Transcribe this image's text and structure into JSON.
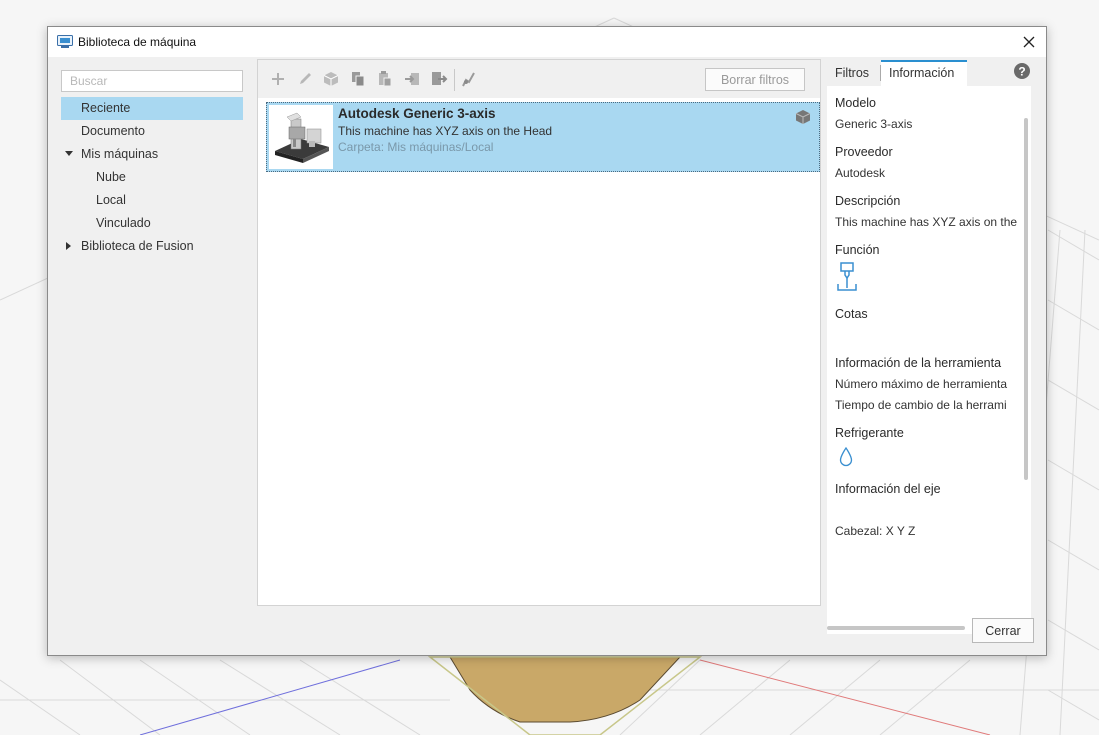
{
  "window": {
    "title": "Biblioteca de máquina"
  },
  "search": {
    "placeholder": "Buscar"
  },
  "tree": [
    {
      "label": "Reciente"
    },
    {
      "label": "Documento"
    },
    {
      "label": "Mis máquinas"
    },
    {
      "label": "Nube"
    },
    {
      "label": "Local"
    },
    {
      "label": "Vinculado"
    },
    {
      "label": "Biblioteca de Fusion"
    }
  ],
  "toolbar": {
    "icons": [
      "add-icon",
      "edit-icon",
      "cube-icon",
      "copy-icon",
      "paste-icon",
      "import-icon",
      "export-icon",
      "post-processor-icon"
    ],
    "clear_filters_label": "Borrar filtros"
  },
  "machine_item": {
    "title": "Autodesk Generic 3-axis",
    "description": "This machine has XYZ axis on the Head",
    "folder": "Carpeta: Mis máquinas/Local"
  },
  "right_panel": {
    "tabs": [
      {
        "label": "Filtros"
      },
      {
        "label": "Información"
      }
    ],
    "model_label": "Modelo",
    "model_value": "Generic 3-axis",
    "vendor_label": "Proveedor",
    "vendor_value": "Autodesk",
    "description_label": "Descripción",
    "description_value": "This machine has XYZ axis on the",
    "function_label": "Función",
    "dimensions_label": "Cotas",
    "tool_info_label": "Información de la herramienta",
    "max_tools": "Número máximo de herramienta",
    "tool_change_time": "Tiempo de cambio de la herrami",
    "coolant_label": "Refrigerante",
    "axis_info_label": "Información del eje",
    "head_axes": "Cabezal: X Y Z"
  },
  "footer": {
    "close_label": "Cerrar"
  },
  "colors": {
    "selection": "#a9d8f1",
    "accent": "#2a8fd0",
    "icon_blue": "#3a8fd0"
  }
}
